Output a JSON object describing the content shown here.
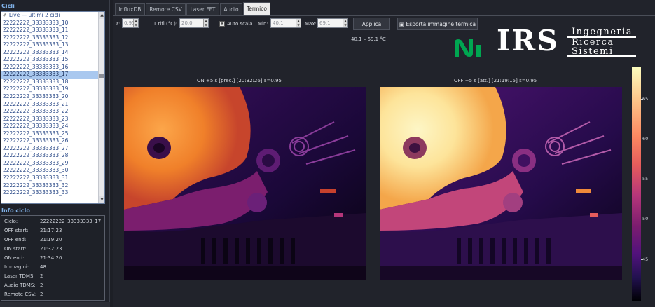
{
  "left": {
    "cicli_title": "Cicli",
    "live_item": "Live — ultimi 2 cicli",
    "cycles": [
      "22222222_33333333_10",
      "22222222_33333333_11",
      "22222222_33333333_12",
      "22222222_33333333_13",
      "22222222_33333333_14",
      "22222222_33333333_15",
      "22222222_33333333_16",
      "22222222_33333333_17",
      "22222222_33333333_18",
      "22222222_33333333_19",
      "22222222_33333333_20",
      "22222222_33333333_21",
      "22222222_33333333_22",
      "22222222_33333333_23",
      "22222222_33333333_24",
      "22222222_33333333_25",
      "22222222_33333333_26",
      "22222222_33333333_27",
      "22222222_33333333_28",
      "22222222_33333333_29",
      "22222222_33333333_30",
      "22222222_33333333_31",
      "22222222_33333333_32",
      "22222222_33333333_33"
    ],
    "selected_cycle": "22222222_33333333_17",
    "info_title": "Info ciclo",
    "info": [
      {
        "k": "Ciclo:",
        "v": "22222222_33333333_17"
      },
      {
        "k": "OFF start:",
        "v": "21:17:23"
      },
      {
        "k": "OFF end:",
        "v": "21:19:20"
      },
      {
        "k": "ON start:",
        "v": "21:32:23"
      },
      {
        "k": "ON end:",
        "v": "21:34:20"
      },
      {
        "k": "Immagini:",
        "v": "48"
      },
      {
        "k": "Laser TDMS:",
        "v": "2"
      },
      {
        "k": "Audio TDMS:",
        "v": "2"
      },
      {
        "k": "Remote CSV:",
        "v": "2"
      }
    ]
  },
  "tabs": [
    "InfluxDB",
    "Remote CSV",
    "Laser FFT",
    "Audio",
    "Termico"
  ],
  "active_tab": "Termico",
  "toolbar": {
    "eps_label": "ε:",
    "eps_value": "0.95",
    "trifl_label": "T rifl.(°C):",
    "trifl_value": "20.0",
    "autoscale_label": "Auto scala",
    "autoscale_checked": true,
    "min_label": "Min:",
    "min_value": "40.1",
    "max_label": "Max:",
    "max_value": "69.1",
    "apply_label": "Applica",
    "export_label": "Esporta immagine termica"
  },
  "range_label": "40.1 – 69.1 °C",
  "logos": {
    "irs_letters": "IRS",
    "irs_words": [
      "Ingegneria",
      "Ricerca",
      "Sistemi"
    ]
  },
  "thermal": {
    "left_caption": "ON  +5 s  [prec.]  [20:32:26]  ε=0.95",
    "right_caption": "OFF −5 s  [att.]  [21:19:15]  ε=0.95"
  },
  "colorbar": {
    "ticks": [
      "65",
      "60",
      "55",
      "50",
      "45"
    ],
    "colormap": [
      "#fcfdbf",
      "#fec287",
      "#fb8761",
      "#e55c5c",
      "#b5367a",
      "#7c1d6f",
      "#51127c",
      "#221150",
      "#000004"
    ]
  },
  "colors": {
    "accent_title": "#7fb0e6",
    "list_text": "#2b4a88",
    "selection": "#a9c8ef",
    "ni_green": "#00a651"
  }
}
